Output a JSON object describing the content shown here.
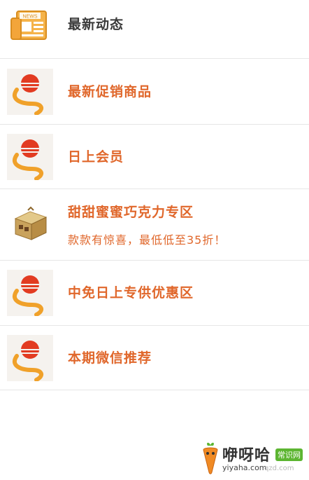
{
  "header": {
    "icon": "news-icon",
    "icon_text": "NEWS",
    "title": "最新动态"
  },
  "items": [
    {
      "icon": "sun-logo-icon",
      "title": "最新促销商品"
    },
    {
      "icon": "sun-logo-icon",
      "title": "日上会员"
    },
    {
      "icon": "chocolate-box-icon",
      "title": "甜甜蜜蜜巧克力专区",
      "subtitle": "款款有惊喜，最低低至35折！"
    },
    {
      "icon": "sun-logo-icon",
      "title": "中免日上专供优惠区"
    },
    {
      "icon": "sun-logo-icon",
      "title": "本期微信推荐"
    }
  ],
  "watermark": {
    "brand": "咿呀哈",
    "badge": "常识网",
    "url": "yiyaha.com",
    "url2": "qzd.com"
  },
  "colors": {
    "accent": "#e0672b",
    "title_dark": "#3a3a3a",
    "divider": "#e6e6e6"
  }
}
